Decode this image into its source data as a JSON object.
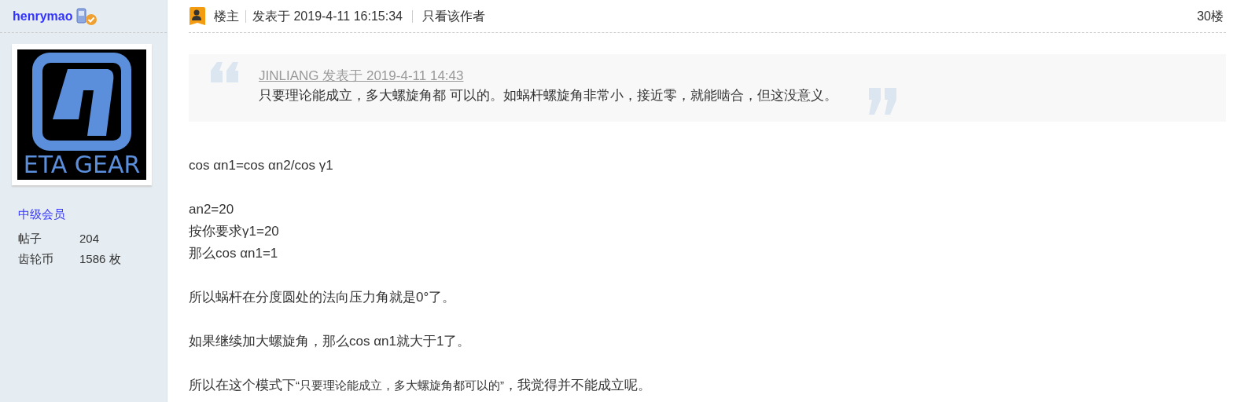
{
  "author": {
    "name": "henrymao",
    "avatar_caption": "ETA GEAR",
    "rank": "中级会员",
    "stats": [
      {
        "label": "帖子",
        "value": "204"
      },
      {
        "label": "齿轮币",
        "value": "1586 枚"
      }
    ]
  },
  "post_header": {
    "role": "楼主",
    "posted": "发表于 2019-4-11 16:15:34",
    "author_only": "只看该作者",
    "floor": "30楼"
  },
  "quote": {
    "source": "JINLIANG 发表于 2019-4-11 14:43",
    "text": "只要理论能成立，多大螺旋角都 可以的。如蜗杆螺旋角非常小，接近零，就能啮合，但这没意义。"
  },
  "paragraphs": [
    [
      "cos αn1=cos αn2/cos γ1"
    ],
    [
      "an2=20",
      "按你要求γ1=20",
      "那么cos αn1=1"
    ],
    [
      "所以蜗杆在分度圆处的法向压力角就是0°了。"
    ],
    [
      "如果继续加大螺旋角，那么cos αn1就大于1了。"
    ]
  ],
  "last_paragraph": [
    {
      "text": "所以在这个模式下",
      "small": false
    },
    {
      "text": "“只要理论能成立，多大螺旋角都可以的”",
      "small": true
    },
    {
      "text": "，我觉得并不能成立呢。",
      "small": false
    }
  ]
}
